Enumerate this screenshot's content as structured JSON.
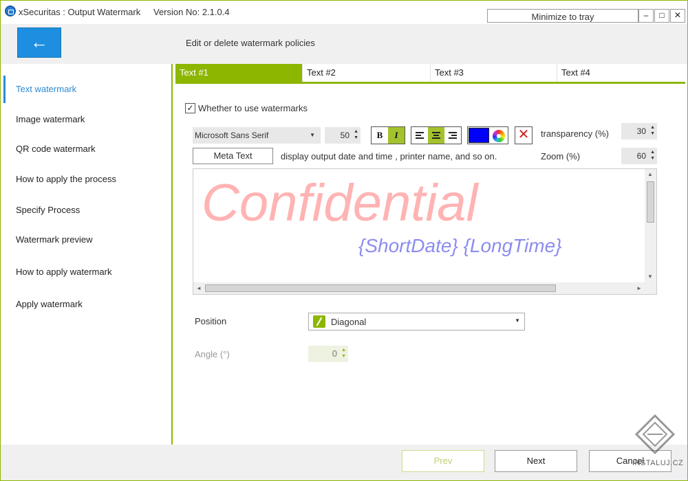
{
  "titlebar": {
    "title": "xSecuritas : Output Watermark",
    "version": "Version No: 2.1.0.4",
    "minimize_to_tray": "Minimize to tray",
    "min_btn": "–",
    "max_btn": "□",
    "close_btn": "✕"
  },
  "header": {
    "back_icon": "←",
    "text": "Edit or delete watermark policies"
  },
  "sidebar": {
    "items": [
      {
        "label": "Text watermark",
        "active": true
      },
      {
        "label": "Image watermark"
      },
      {
        "label": "QR code watermark"
      },
      {
        "label": "How to apply the process"
      },
      {
        "label": "Specify Process"
      },
      {
        "label": "Watermark preview"
      },
      {
        "label": "How to apply watermark"
      },
      {
        "label": "Apply watermark"
      }
    ]
  },
  "tabs": [
    {
      "label": "Text #1",
      "active": true
    },
    {
      "label": "Text #2"
    },
    {
      "label": "Text #3"
    },
    {
      "label": "Text #4"
    }
  ],
  "options": {
    "use_watermark_label": "Whether to use watermarks",
    "use_watermark_checked": true,
    "check_mark": "✓",
    "font_name": "Microsoft Sans Serif",
    "font_size": "50",
    "bold_label": "B",
    "italic_label": "I",
    "color": "#0000ff",
    "transparency_label": "transparency (%)",
    "transparency_value": "30",
    "zoom_label": "Zoom (%)",
    "zoom_value": "60",
    "meta_text_label": "Meta Text",
    "meta_text_desc": "display output date and time , printer name, and so on."
  },
  "editor": {
    "line1": "Confidential",
    "line2": "{ShortDate}  {LongTime}"
  },
  "position": {
    "label": "Position",
    "value": "Diagonal"
  },
  "angle": {
    "label": "Angle (°)",
    "value": "0"
  },
  "nav": {
    "prev": "Prev",
    "next": "Next",
    "cancel": "Cancel"
  },
  "branding": {
    "watermark_text": "INSTALUJ.CZ"
  },
  "colors": {
    "accent_green": "#8db600",
    "accent_blue": "#1e8fe0"
  }
}
